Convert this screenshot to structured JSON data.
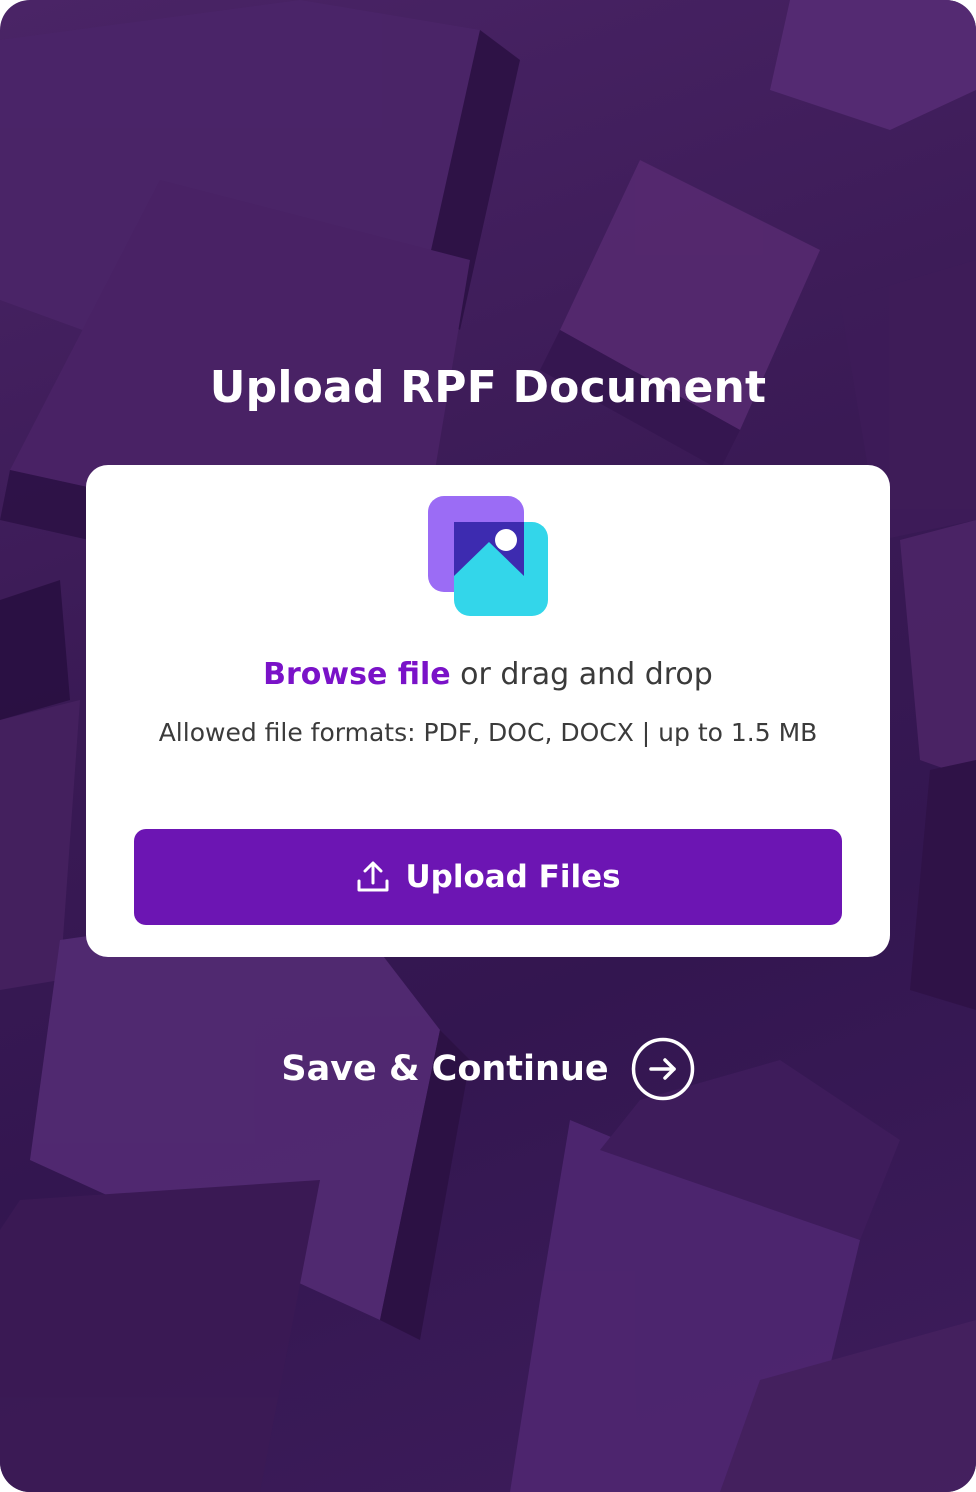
{
  "page": {
    "title": "Upload RPF Document"
  },
  "upload_card": {
    "icon": "image-file-icon",
    "browse_link": "Browse file",
    "browse_suffix": " or drag and drop",
    "formats_text": "Allowed file formats: PDF, DOC, DOCX | up to 1.5 MB",
    "button": {
      "icon": "upload-icon",
      "label": "Upload Files"
    }
  },
  "footer": {
    "save_label": "Save & Continue",
    "icon": "arrow-right-circle-icon"
  },
  "colors": {
    "background": "#3a1a55",
    "card": "#ffffff",
    "accent_purple": "#6c15b3",
    "link_purple": "#7a12c8",
    "icon_violet": "#9b6cf5",
    "icon_cyan": "#33d6ea",
    "icon_indigo": "#3d2bb0",
    "text_white": "#ffffff",
    "text_dark": "#3a3a3a"
  }
}
